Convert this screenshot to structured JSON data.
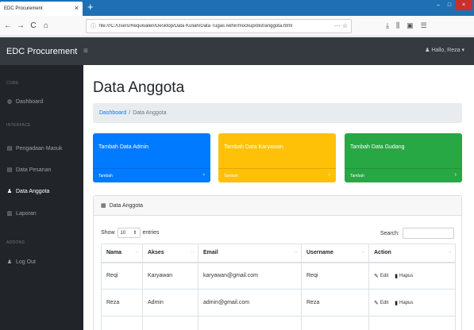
{
  "browser": {
    "tab_title": "EDC Procurement",
    "tab_close": "×",
    "new_tab": "+",
    "url": "file:///C:/Users/Requivalen/Desktop/Data Kuliah/Data Tugas Akhir/mockup/dist/anggota.html",
    "url_actions": "··· ☆",
    "back": "←",
    "forward": "→",
    "reload": "C",
    "home": "⌂",
    "toolbar": [
      "⤓",
      "⫼",
      "▣",
      "☰"
    ],
    "window_controls": [
      "–",
      "□",
      "×"
    ]
  },
  "app": {
    "brand": "EDC Procurement",
    "toggle": "≡",
    "user_menu": "Hallo, Reza ▾"
  },
  "sidebar": {
    "headings": [
      "CORE",
      "INTERFACE",
      "ADDONS"
    ],
    "items": [
      {
        "label": "Dashboard",
        "icon": "◍"
      },
      {
        "label": "Pengadaan Masuk",
        "icon": "▤"
      },
      {
        "label": "Data Pesanan",
        "icon": "▤"
      },
      {
        "label": "Data Anggota",
        "icon": "♟"
      },
      {
        "label": "Laporan",
        "icon": "▥"
      },
      {
        "label": "Log Out",
        "icon": "♟"
      }
    ]
  },
  "main": {
    "title": "Data Anggota",
    "breadcrumb": {
      "link": "Dashboard",
      "sep": "/",
      "current": "Data Anggota"
    },
    "cards": [
      {
        "title": "Tambah Data Admin",
        "footer": "Tambah",
        "color": "#007bff"
      },
      {
        "title": "Tambah Data Karyawan",
        "footer": "Tambah",
        "color": "#ffc107"
      },
      {
        "title": "Tambah Data Gudang",
        "footer": "Tambah",
        "color": "#28a745"
      }
    ],
    "card_chevron": "›",
    "table_card": {
      "header": "Data Anggota",
      "header_icon": "▦",
      "show_label": "Show",
      "entries_value": "10",
      "entries_arrow": "⇕",
      "entries_label": "entries",
      "search_label": "Search:",
      "search_value": "",
      "sort_glyph": "↑↓",
      "columns": [
        "Nama",
        "Akses",
        "Email",
        "Username",
        "Action"
      ],
      "rows": [
        {
          "nama": "Reqi",
          "akses": "Karyawan",
          "email": "karyawan@gmail.com",
          "username": "Reqi"
        },
        {
          "nama": "Reza",
          "akses": "Admin",
          "email": "admin@gmail.com",
          "username": "Reza"
        }
      ],
      "edit_label": "Edit",
      "edit_icon": "✎",
      "delete_label": "Hapus",
      "delete_icon": "▮"
    }
  }
}
